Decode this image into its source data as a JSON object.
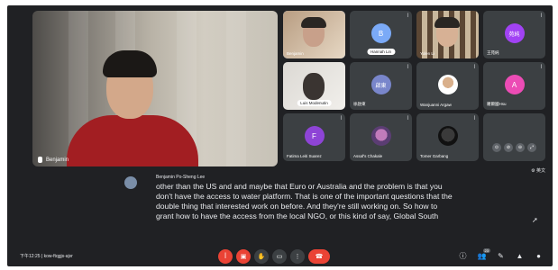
{
  "main_speaker": {
    "name": "Benjamin"
  },
  "tiles": [
    {
      "name": "Benjamin",
      "type": "video",
      "active": true
    },
    {
      "name": "Hannah Lin",
      "type": "avatar",
      "initial": "B",
      "color": "#7baaf7",
      "style": "pill"
    },
    {
      "name": "Yolen Li",
      "type": "video"
    },
    {
      "name": "王苑純",
      "type": "avatar",
      "initial": "苑純",
      "color": "#a142f4"
    },
    {
      "name": "Luis Modenutin",
      "type": "video",
      "style": "pill"
    },
    {
      "name": "徐啟東",
      "type": "avatar",
      "initial": "啟東",
      "color": "#7986cb"
    },
    {
      "name": "Wanjuanni Argaw",
      "type": "avatar",
      "initial": "",
      "color": "#ffffff"
    },
    {
      "name": "羅爾國Hsu",
      "type": "avatar",
      "initial": "A",
      "color": "#ec4cb5"
    },
    {
      "name": "Fatima Leiti Suarez",
      "type": "avatar",
      "initial": "F",
      "color": "#8e44d6"
    },
    {
      "name": "Assaf's Chakale",
      "type": "avatar",
      "initial": "",
      "color": "#9a6bd6"
    },
    {
      "name": "Tomer Garbang",
      "type": "avatar",
      "initial": "",
      "color": "#202124"
    }
  ],
  "captions": {
    "speaker": "Benjamin Po-Sheng Lee",
    "text": "other than the US and and maybe that Euro or Australia and the problem is that you don't have the access to water platform. That is one of the important questions that the double thing that interested work on before. And they're still working on. So how to grant how to have the access from the local NGO, or this kind of say, Global South",
    "cc_label": "英文"
  },
  "bottom_bar": {
    "time": "下午12:25",
    "meeting_code": "kow-ftqgjs-ajvr",
    "people_count": "23"
  },
  "icons": {
    "mic": "mic-off-icon",
    "camera": "camera-off-icon",
    "hand": "raise-hand-icon",
    "captions": "captions-icon",
    "more": "more-options-icon",
    "end": "end-call-icon"
  }
}
